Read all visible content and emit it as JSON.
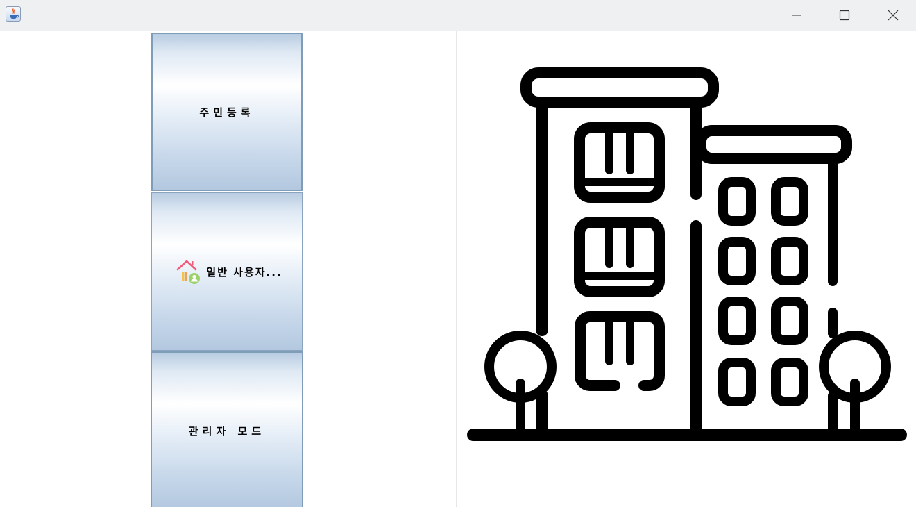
{
  "window": {
    "icon": "java-cup-icon",
    "controls": {
      "minimize": "minimize-icon",
      "maximize": "maximize-icon",
      "close": "close-icon"
    }
  },
  "menu": {
    "resident_register": {
      "label": "주민등록"
    },
    "general_user": {
      "label": "일반 사용자...",
      "icon": "house-user-icon"
    },
    "admin_mode": {
      "label": "관리자 모드"
    }
  },
  "illustration": {
    "icon": "apartment-building-icon"
  },
  "colors": {
    "button_border": "#7f9db9",
    "button_gradient_mid": "#ffffff",
    "button_gradient_edge": "#b8cce2",
    "titlebar": "#eff0f1"
  }
}
